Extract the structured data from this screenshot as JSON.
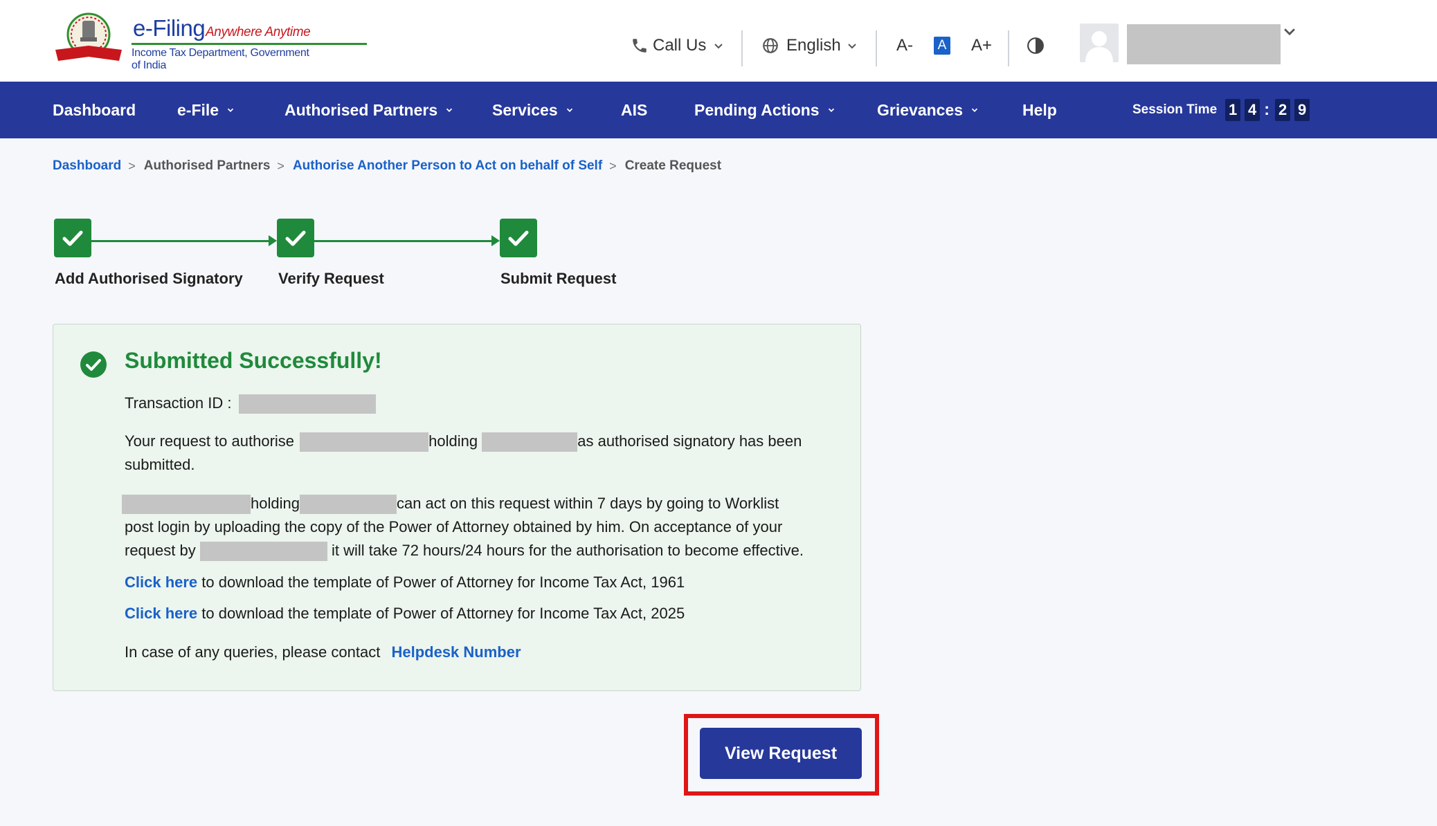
{
  "brand": {
    "title": "e-Filing",
    "tagline": "Anywhere Anytime",
    "subtitle": "Income Tax Department, Government of India",
    "emblem_label": "INCOME TAX DEPARTMENT"
  },
  "header": {
    "call_us": "Call Us",
    "language": "English",
    "font_decrease": "A-",
    "font_reset": "A",
    "font_increase": "A+",
    "contrast_icon": "contrast-icon"
  },
  "nav": {
    "items": [
      {
        "label": "Dashboard"
      },
      {
        "label": "e-File"
      },
      {
        "label": "Authorised Partners"
      },
      {
        "label": "Services"
      },
      {
        "label": "AIS"
      },
      {
        "label": "Pending Actions"
      },
      {
        "label": "Grievances"
      },
      {
        "label": "Help"
      }
    ],
    "session_label": "Session Time",
    "session_digits": [
      "1",
      "4",
      "2",
      "9"
    ],
    "session_sep": ":"
  },
  "breadcrumb": {
    "items": [
      {
        "label": "Dashboard"
      },
      {
        "label": "Authorised Partners"
      },
      {
        "label": "Authorise Another Person to Act on behalf of Self"
      },
      {
        "label": "Create Request"
      }
    ],
    "sep": ">"
  },
  "steps": [
    {
      "label": "Add Authorised Signatory",
      "status": "done"
    },
    {
      "label": "Verify Request",
      "status": "done"
    },
    {
      "label": "Submit Request",
      "status": "done"
    }
  ],
  "result": {
    "title": "Submitted Successfully!",
    "transaction_label": "Transaction ID :",
    "p1_a": "Your request to authorise",
    "p1_b": "holding",
    "p1_c": "as authorised signatory has been",
    "p1_d": "submitted.",
    "p2_a": "holding",
    "p2_b": "can act on this request within 7 days by going to Worklist",
    "p2_c": "post login by uploading the copy of the Power of Attorney obtained by him. On acceptance of your",
    "p2_d": "request by",
    "p2_e": "it will take 72 hours/24 hours for the authorisation to become effective.",
    "link1": "Click here",
    "link1_text": "to download the template of Power of Attorney for Income Tax Act, 1961",
    "link2": "Click here",
    "link2_text": "to download the template of Power of Attorney for Income Tax Act, 2025",
    "contact_text": "In case of any queries, please contact",
    "helpdesk": "Helpdesk Number"
  },
  "actions": {
    "view_request": "View Request"
  },
  "colors": {
    "nav_bg": "#26389a",
    "success_green": "#1f8a3b",
    "link_blue": "#1a61c8",
    "highlight_red": "#e01515"
  }
}
